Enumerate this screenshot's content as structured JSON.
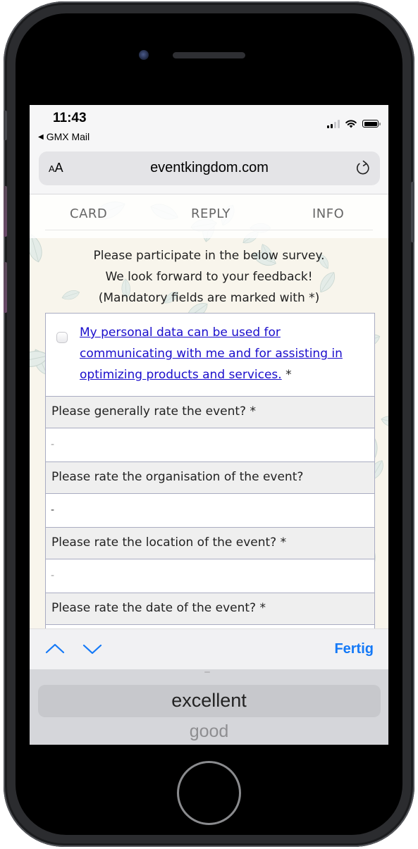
{
  "status_bar": {
    "time": "11:43",
    "back_app": "GMX Mail",
    "back_icon": "back-triangle-icon",
    "signal_bars_active": 2,
    "signal_bars_total": 4,
    "icons": [
      "cellular-signal-icon",
      "wifi-icon",
      "battery-icon"
    ]
  },
  "browser": {
    "text_size_label_small": "A",
    "text_size_label_large": "A",
    "url": "eventkingdom.com",
    "reload_icon": "reload-icon"
  },
  "tabs": [
    {
      "label": "CARD"
    },
    {
      "label": "REPLY"
    },
    {
      "label": "INFO"
    }
  ],
  "intro": {
    "line1": "Please participate in the below survey.",
    "line2": "We look forward to your feedback!",
    "line3": "(Mandatory fields are marked with *)"
  },
  "consent": {
    "checked": false,
    "link_line1": "My personal data can be used for",
    "link_line2": "communicating with me and for assisting in",
    "link_line3": "optimizing products and services.",
    "required_mark": "*"
  },
  "questions": [
    {
      "label": "Please generally rate the event? *",
      "value": "-"
    },
    {
      "label": "Please rate the organisation of the event?",
      "value": "-"
    },
    {
      "label": "Please rate the location of the event? *",
      "value": "-"
    },
    {
      "label": "Please rate the date of the event? *",
      "value": ""
    }
  ],
  "accessory": {
    "prev_icon": "chevron-up-icon",
    "next_icon": "chevron-down-icon",
    "done_label": "Fertig",
    "accent_color": "#1479f7"
  },
  "picker": {
    "selected": "excellent",
    "next": "good"
  },
  "colors": {
    "link": "#1a0dcc",
    "form_border": "#a9acc2",
    "question_bg": "#efefef",
    "page_bg": "#f8f5ec"
  }
}
